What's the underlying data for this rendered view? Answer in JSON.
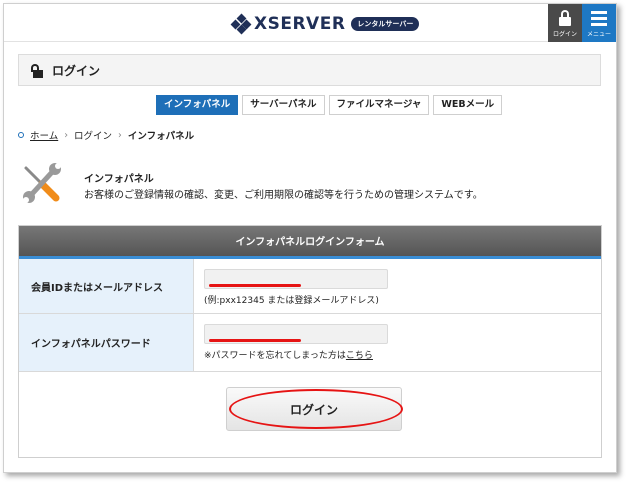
{
  "header": {
    "logo_text": "XSERVER",
    "logo_badge": "レンタルサーバー",
    "login_label": "ログイン",
    "menu_label": "メニュー"
  },
  "page": {
    "title": "ログイン"
  },
  "tabs": [
    {
      "label": "インフォパネル",
      "active": true
    },
    {
      "label": "サーバーパネル",
      "active": false
    },
    {
      "label": "ファイルマネージャ",
      "active": false
    },
    {
      "label": "WEBメール",
      "active": false
    }
  ],
  "breadcrumb": {
    "home": "ホーム",
    "login": "ログイン",
    "current": "インフォパネル"
  },
  "intro": {
    "title": "インフォパネル",
    "description": "お客様のご登録情報の確認、変更、ご利用期限の確認等を行うための管理システムです。"
  },
  "form": {
    "heading": "インフォパネルログインフォーム",
    "id_label": "会員IDまたはメールアドレス",
    "id_hint": "(例:pxx12345 または登録メールアドレス)",
    "password_label": "インフォパネルパスワード",
    "password_hint": "※パスワードを忘れてしまった方は",
    "password_link": "こちら",
    "submit_label": "ログイン"
  },
  "colors": {
    "accent": "#1e6fb8",
    "annotation": "#e61414",
    "brand": "#1f2f57"
  }
}
